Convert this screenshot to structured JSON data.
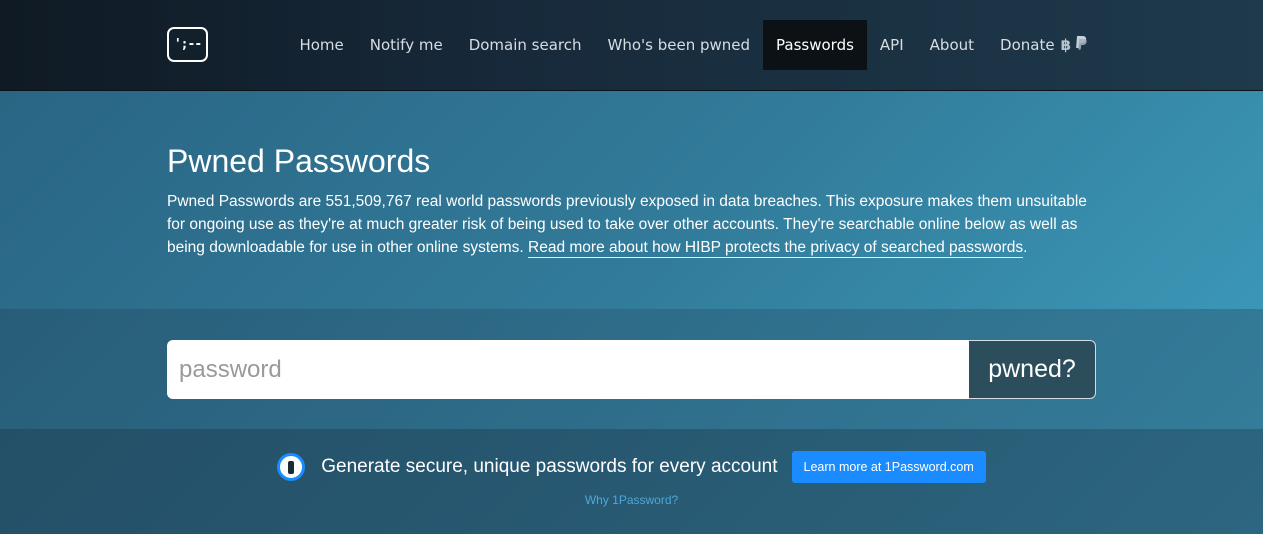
{
  "logo": {
    "text": "';--"
  },
  "nav": {
    "items": [
      {
        "label": "Home"
      },
      {
        "label": "Notify me"
      },
      {
        "label": "Domain search"
      },
      {
        "label": "Who's been pwned"
      },
      {
        "label": "Passwords",
        "active": true
      },
      {
        "label": "API"
      },
      {
        "label": "About"
      },
      {
        "label": "Donate"
      }
    ],
    "donate_icons": [
      "bitcoin-icon",
      "paypal-icon"
    ]
  },
  "hero": {
    "title": "Pwned Passwords",
    "text_before_link": "Pwned Passwords are 551,509,767 real world passwords previously exposed in data breaches. This exposure makes them unsuitable for ongoing use as they're at much greater risk of being used to take over other accounts. They're searchable online below as well as being downloadable for use in other online systems. ",
    "link_text": "Read more about how HIBP protects the privacy of searched passwords",
    "text_after_link": "."
  },
  "search": {
    "placeholder": "password",
    "button_label": "pwned?"
  },
  "promo": {
    "icon": "1password-icon",
    "text": "Generate secure, unique passwords for every account",
    "button_label": "Learn more at 1Password.com",
    "why_link": "Why 1Password?"
  },
  "colors": {
    "nav_active_bg": "#0b1115",
    "search_button_bg": "#2c4d5c",
    "promo_button_bg": "#1a8cff",
    "why_link": "#4ea7d8"
  }
}
